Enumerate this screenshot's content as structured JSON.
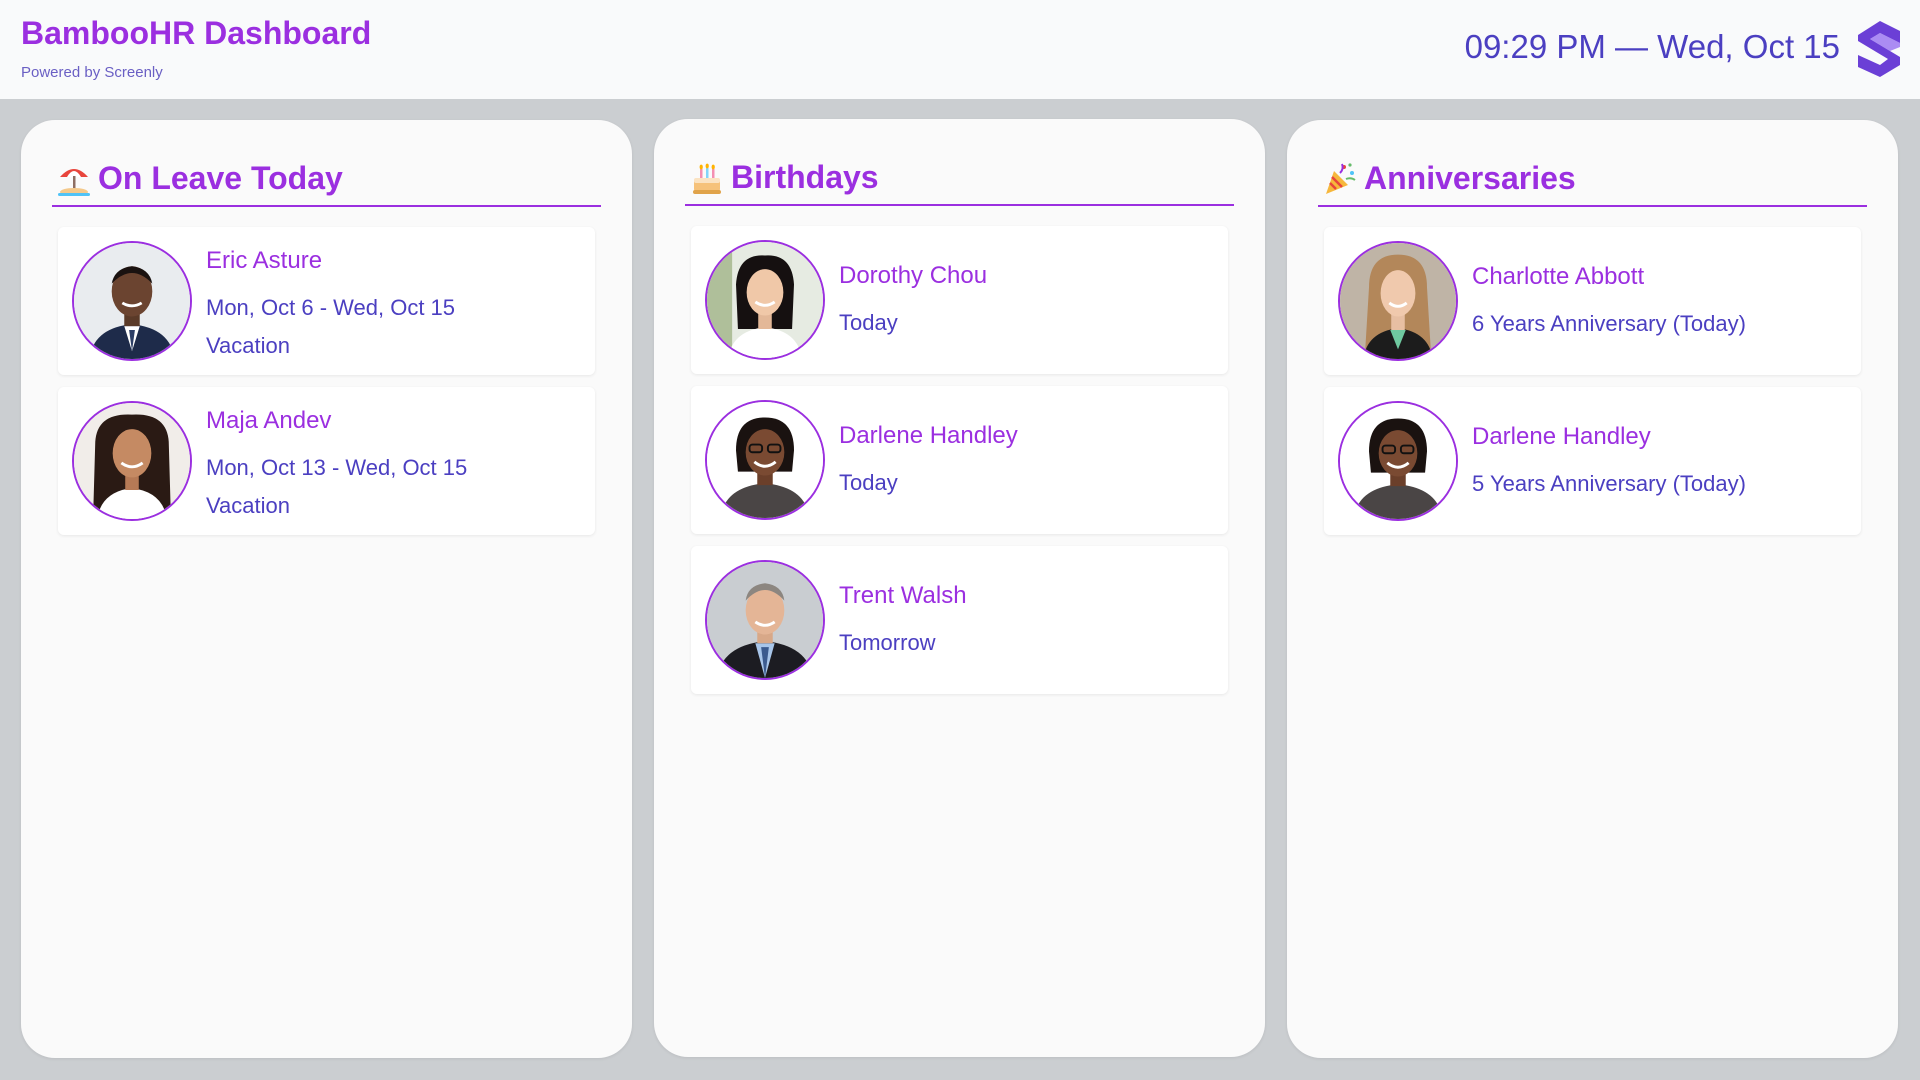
{
  "header": {
    "title": "BambooHR Dashboard",
    "subtitle": "Powered by Screenly",
    "clock": "09:29 PM — Wed, Oct 15",
    "logo_icon": "screenly-logo"
  },
  "colors": {
    "accent": "#9b2fe0",
    "text": "#4b3fc1",
    "background": "#cbced1"
  },
  "columns": [
    {
      "emoji": "🏖️",
      "emoji_icon": "beach-umbrella-icon",
      "title": "On Leave Today",
      "items": [
        {
          "name": "Eric Asture",
          "line1": "Mon, Oct 6 - Wed, Oct 15",
          "line2": "Vacation"
        },
        {
          "name": "Maja Andev",
          "line1": "Mon, Oct 13 - Wed, Oct 15",
          "line2": "Vacation"
        }
      ]
    },
    {
      "emoji": "🎂",
      "emoji_icon": "birthday-cake-icon",
      "title": "Birthdays",
      "items": [
        {
          "name": "Dorothy Chou",
          "line1": "Today"
        },
        {
          "name": "Darlene Handley",
          "line1": "Today"
        },
        {
          "name": "Trent Walsh",
          "line1": "Tomorrow"
        }
      ]
    },
    {
      "emoji": "🎉",
      "emoji_icon": "party-popper-icon",
      "title": "Anniversaries",
      "items": [
        {
          "name": "Charlotte Abbott",
          "line1": "6 Years Anniversary (Today)"
        },
        {
          "name": "Darlene Handley",
          "line1": "5 Years Anniversary (Today)"
        }
      ]
    }
  ]
}
